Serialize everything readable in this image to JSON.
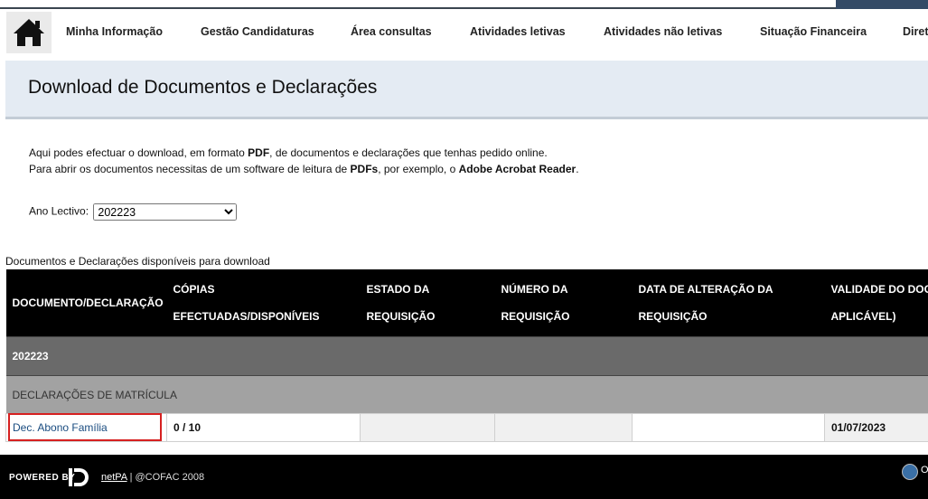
{
  "nav": {
    "items": [
      {
        "label": "Minha Informação"
      },
      {
        "label": "Gestão Candidaturas"
      },
      {
        "label": "Área consultas"
      },
      {
        "label": "Atividades letivas"
      },
      {
        "label": "Atividades não letivas"
      },
      {
        "label": "Situação Financeira"
      },
      {
        "label": "Diret"
      }
    ],
    "home_icon": "house-icon"
  },
  "page": {
    "title": "Download de Documentos e Declarações"
  },
  "intro": {
    "line1_a": "Aqui podes efectuar o download, em formato ",
    "line1_b": "PDF",
    "line1_c": ", de documentos e declarações que tenhas pedido online.",
    "line2_a": "Para abrir os documentos necessitas de um software de leitura de ",
    "line2_b": "PDFs",
    "line2_c": ", por exemplo, o ",
    "line2_d": "Adobe Acrobat Reader",
    "line2_e": "."
  },
  "filter": {
    "label": "Ano Lectivo:",
    "selected": "202223"
  },
  "table": {
    "caption": "Documentos e Declarações disponíveis para download",
    "headers": [
      {
        "line1": "DOCUMENTO/DECLARAÇÃO",
        "line2": ""
      },
      {
        "line1": "CÓPIAS",
        "line2": "EFECTUADAS/DISPONÍVEIS"
      },
      {
        "line1": "ESTADO DA",
        "line2": "REQUISIÇÃO"
      },
      {
        "line1": "NÚMERO DA",
        "line2": "REQUISIÇÃO"
      },
      {
        "line1": "DATA DE ALTERAÇÃO DA",
        "line2": "REQUISIÇÃO"
      },
      {
        "line1": "VALIDADE DO DOC",
        "line2": "APLICÁVEL)"
      }
    ],
    "year_row": "202223",
    "group_row": "DECLARAÇÕES DE MATRÍCULA",
    "item": {
      "document": "Dec. Abono Família",
      "copies": "0 / 10",
      "status": "",
      "number": "",
      "date_changed": "",
      "validity": "01/07/2023"
    }
  },
  "footer": {
    "powered": "Powered by",
    "brand": "netPA",
    "copyright": " | @COFAC 2008",
    "right_text": "O"
  },
  "colors": {
    "header_bg": "#000000",
    "banner_bg": "#e4ebf3",
    "link": "#1a4c80",
    "highlight": "#d62020"
  }
}
